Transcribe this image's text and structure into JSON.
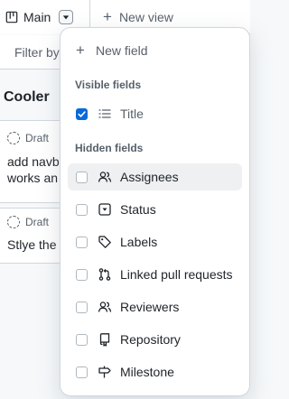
{
  "colors": {
    "accent": "#0969da",
    "text": "#1f2328",
    "muted": "#57606a",
    "border": "#d0d7de",
    "hover": "#eef0f2"
  },
  "tabs": {
    "current_view": "Main",
    "new_view": "New view"
  },
  "filter": {
    "text": "Filter by"
  },
  "board": {
    "column_title": "Cooler",
    "cards": [
      {
        "status": "Draft",
        "text_line1": "add navb",
        "text_line2": "works an",
        "peek": "i"
      },
      {
        "status": "Draft",
        "text_line1": "Stlye the"
      }
    ]
  },
  "menu": {
    "new_field": "New field",
    "visible_heading": "Visible fields",
    "visible_fields": [
      {
        "label": "Title",
        "icon": "text-lines-icon",
        "checked": true
      }
    ],
    "hidden_heading": "Hidden fields",
    "hidden_fields": [
      {
        "label": "Assignees",
        "icon": "people-icon",
        "checked": false,
        "hovered": true
      },
      {
        "label": "Status",
        "icon": "single-select-icon",
        "checked": false
      },
      {
        "label": "Labels",
        "icon": "tag-icon",
        "checked": false
      },
      {
        "label": "Linked pull requests",
        "icon": "git-pull-request-icon",
        "checked": false
      },
      {
        "label": "Reviewers",
        "icon": "people-icon",
        "checked": false
      },
      {
        "label": "Repository",
        "icon": "repo-icon",
        "checked": false
      },
      {
        "label": "Milestone",
        "icon": "milestone-icon",
        "checked": false
      }
    ]
  }
}
